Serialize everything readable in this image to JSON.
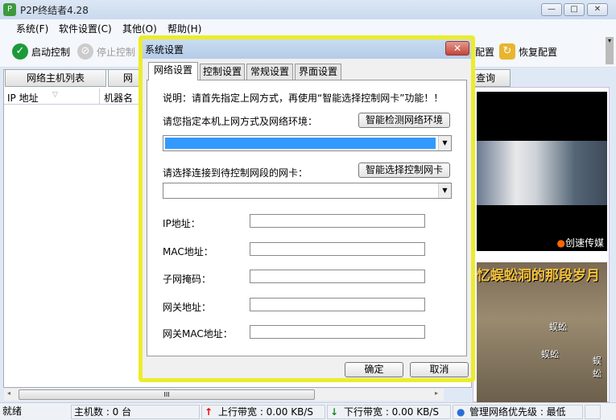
{
  "window": {
    "title": "P2P终结者4.28",
    "minimize": "—",
    "maximize": "□",
    "close": "✕"
  },
  "menu": [
    "系统(F)",
    "软件设置(C)",
    "其他(O)",
    "帮助(H)"
  ],
  "toolbar": {
    "start": "启动控制",
    "stop": "停止控制",
    "save_partial": "配置",
    "restore": "恢复配置"
  },
  "main_tabs": [
    "网络主机列表",
    "网",
    "查询"
  ],
  "list_columns": [
    "IP 地址",
    "机器名"
  ],
  "ads": {
    "caption1": "创速传媒",
    "title2": "忆蜈蚣洞的那段岁月",
    "monster": "蜈蚣"
  },
  "status": {
    "ready": "就绪",
    "hosts": "主机数 : 0 台",
    "upload": "上行带宽 : 0.00 KB/S",
    "download": "下行带宽 : 0.00 KB/S",
    "priority": "管理网络优先级 : 最低"
  },
  "dialog": {
    "title": "系统设置",
    "tabs": [
      "网络设置",
      "控制设置",
      "常规设置",
      "界面设置"
    ],
    "note": "说明：请首先指定上网方式，再使用“智能选择控制网卡”功能！！",
    "env_label": "请您指定本机上网方式及网络环境：",
    "detect_button": "智能检测网络环境",
    "env_value": "",
    "nic_label": "请选择连接到待控制网段的网卡：",
    "select_nic_button": "智能选择控制网卡",
    "nic_value": "",
    "fields": [
      {
        "label": "IP地址：",
        "value": ""
      },
      {
        "label": "MAC地址：",
        "value": ""
      },
      {
        "label": "子网掩码：",
        "value": ""
      },
      {
        "label": "网关地址：",
        "value": ""
      },
      {
        "label": "网关MAC地址：",
        "value": ""
      }
    ],
    "ok": "确定",
    "cancel": "取消"
  },
  "colors": {
    "highlight": "#3399ff",
    "dialog_border": "#ecec2c"
  }
}
